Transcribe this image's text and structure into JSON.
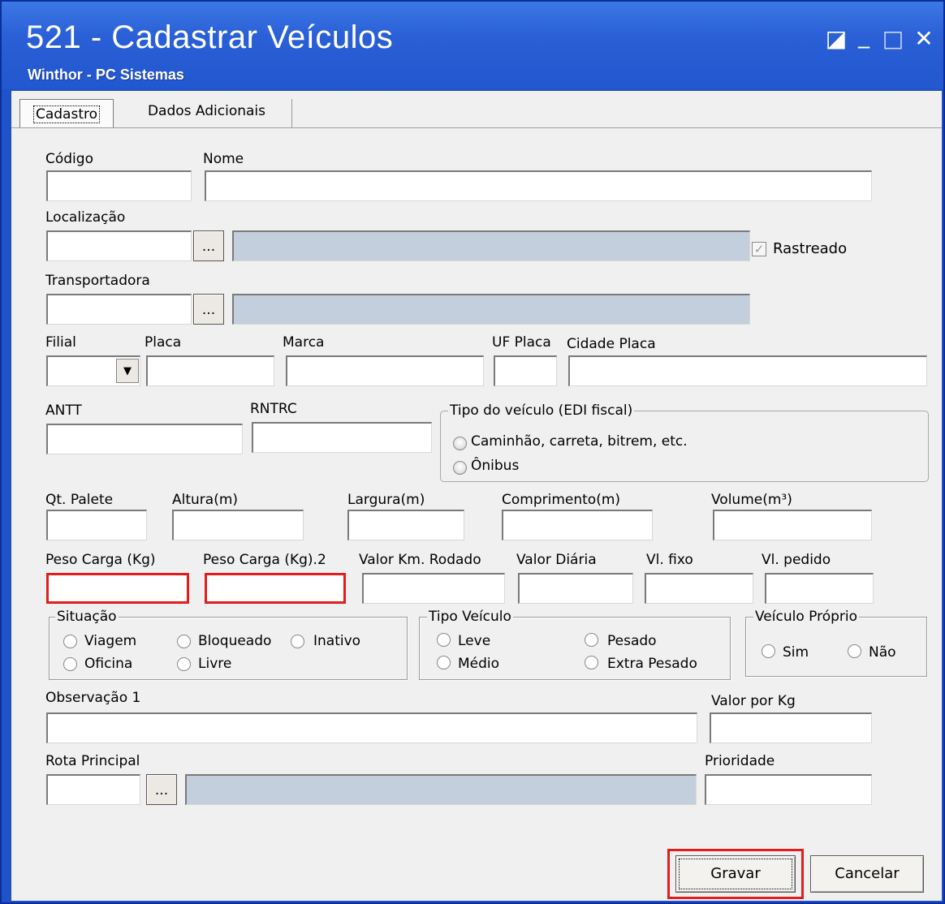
{
  "window": {
    "title": "521 - Cadastrar Veículos",
    "subtitle": "Winthor - PC Sistemas",
    "buttons": {
      "restore": "◪",
      "minimize": "_",
      "maximize": "□",
      "close": "✕"
    }
  },
  "tabs": [
    "Cadastro",
    "Dados Adicionais"
  ],
  "fields": {
    "codigo": "Código",
    "nome": "Nome",
    "localizacao": "Localização",
    "rastreado": "Rastreado",
    "transportadora": "Transportadora",
    "filial": "Filial",
    "placa": "Placa",
    "marca": "Marca",
    "uf_placa": "UF Placa",
    "cidade_placa": "Cidade Placa",
    "antt": "ANTT",
    "rntrc": "RNTRC",
    "qt_palete": "Qt. Palete",
    "altura": "Altura(m)",
    "largura": "Largura(m)",
    "comprimento": "Comprimento(m)",
    "volume": "Volume(m³)",
    "peso_carga": "Peso Carga (Kg)",
    "peso_carga2": "Peso Carga (Kg).2",
    "valor_km": "Valor Km. Rodado",
    "valor_diaria": "Valor Diária",
    "vl_fixo": "Vl. fixo",
    "vl_pedido": "Vl. pedido",
    "observacao": "Observação 1",
    "valor_kg": "Valor por Kg",
    "rota": "Rota Principal",
    "prioridade": "Prioridade",
    "browse": "..."
  },
  "groups": {
    "tipo_edi": {
      "label": "Tipo do veículo (EDI fiscal)",
      "options": [
        "Caminhão, carreta, bitrem, etc.",
        "Ônibus"
      ]
    },
    "situacao": {
      "label": "Situação",
      "options": [
        "Viagem",
        "Bloqueado",
        "Inativo",
        "Oficina",
        "Livre"
      ]
    },
    "tipo_veiculo": {
      "label": "Tipo  Veículo",
      "options": [
        "Leve",
        "Pesado",
        "Médio",
        "Extra Pesado"
      ]
    },
    "proprio": {
      "label": "Veículo Próprio",
      "options": [
        "Sim",
        "Não"
      ]
    }
  },
  "actions": {
    "save": "Gravar",
    "cancel": "Cancelar"
  }
}
